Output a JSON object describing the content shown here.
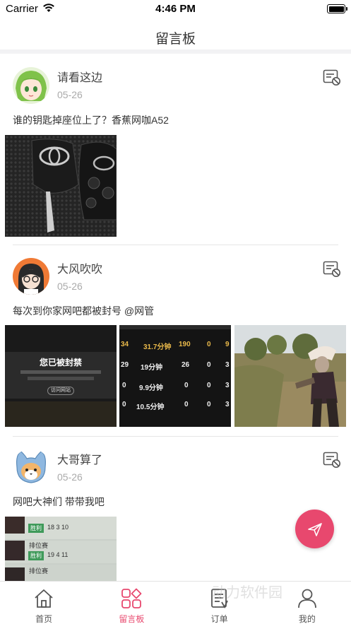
{
  "status": {
    "carrier": "Carrier",
    "time": "4:46 PM"
  },
  "nav": {
    "title": "留言板"
  },
  "posts": [
    {
      "username": "请看这边",
      "date": "05-26",
      "content": "谁的钥匙掉座位上了？香蕉网咖A52"
    },
    {
      "username": "大风吹吹",
      "date": "05-26",
      "content": "每次到你家网吧都被封号 @网管",
      "ban_dialog": {
        "title": "您已被封禁",
        "button": "访问网站"
      },
      "stats_rows": [
        [
          "34",
          "31.7分钟",
          "190",
          "0",
          "9"
        ],
        [
          "29",
          "19分钟",
          "26",
          "0",
          "3"
        ],
        [
          "0",
          "9.9分钟",
          "0",
          "0",
          "3"
        ],
        [
          "0",
          "10.5分钟",
          "0",
          "0",
          "3"
        ]
      ]
    },
    {
      "username": "大哥算了",
      "date": "05-26",
      "content": "网吧大神们 带带我吧",
      "match_rows": [
        {
          "title": "",
          "badge": "胜利",
          "stats": "18 3 10"
        },
        {
          "title": "排位赛",
          "badge": "胜利",
          "stats": "19 4 11"
        },
        {
          "title": "排位赛",
          "badge": "",
          "stats": ""
        }
      ]
    }
  ],
  "tabs": [
    {
      "label": "首页",
      "icon": "home-icon",
      "active": false
    },
    {
      "label": "留言板",
      "icon": "grid-icon",
      "active": true
    },
    {
      "label": "订单",
      "icon": "order-icon",
      "active": false
    },
    {
      "label": "我的",
      "icon": "user-icon",
      "active": false
    }
  ],
  "watermark": "动力软件园",
  "colors": {
    "accent": "#e8486e",
    "nav_separator": "#f2f2f4"
  }
}
